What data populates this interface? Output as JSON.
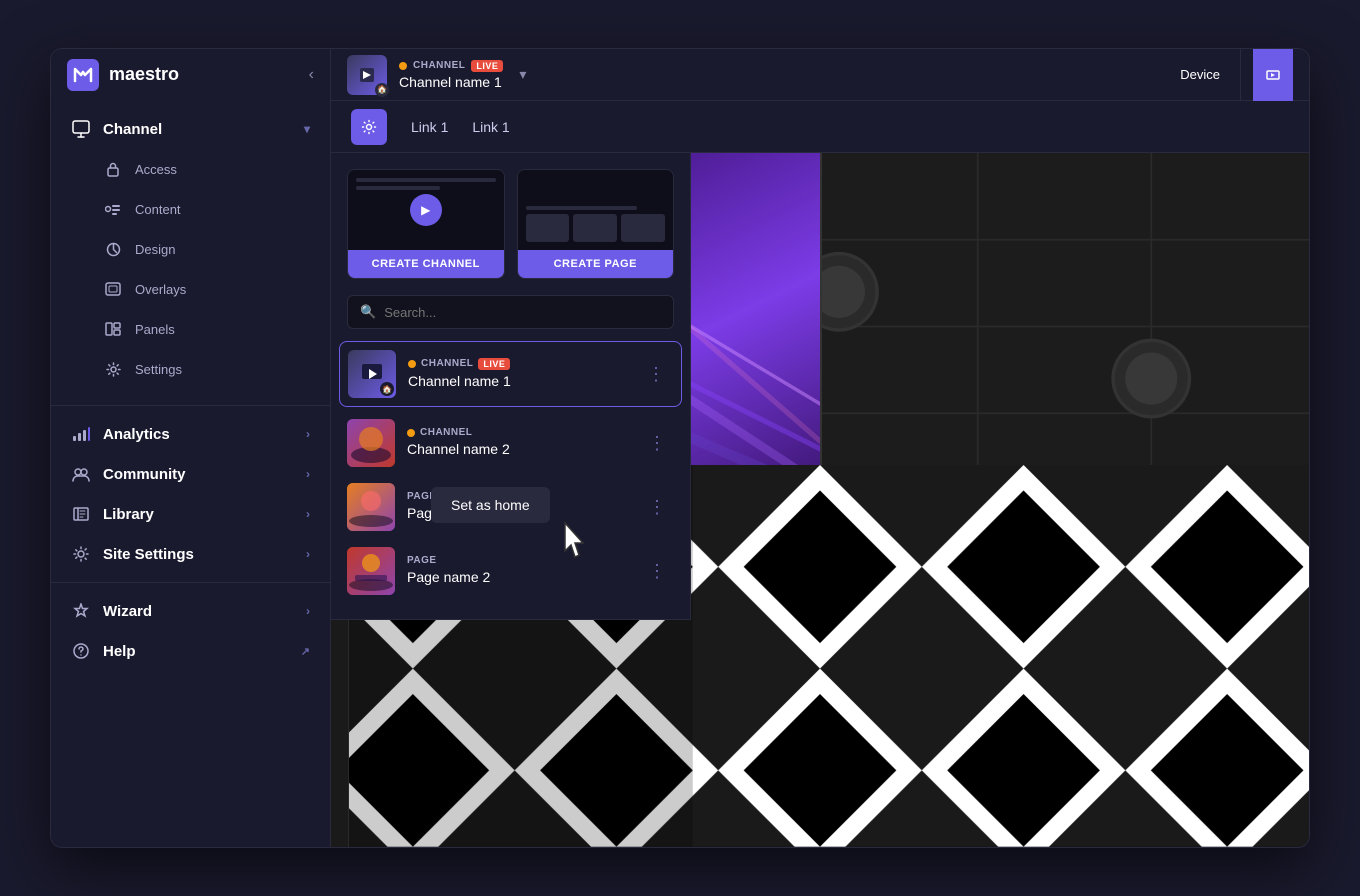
{
  "app": {
    "name": "maestro",
    "logo_letter": "M"
  },
  "top_bar": {
    "channel_badge": "CHANNEL",
    "live_badge": "LIVE",
    "channel_name": "Channel name 1",
    "device_label": "Device",
    "collapse_icon": "‹"
  },
  "sidebar": {
    "sections": [
      {
        "id": "channel",
        "label": "Channel",
        "icon": "▦",
        "has_chevron": true,
        "sub_items": [
          {
            "id": "access",
            "label": "Access",
            "icon": "🔒"
          },
          {
            "id": "content",
            "label": "Content",
            "icon": "📹"
          },
          {
            "id": "design",
            "label": "Design",
            "icon": "🎨"
          },
          {
            "id": "overlays",
            "label": "Overlays",
            "icon": "⬛"
          },
          {
            "id": "panels",
            "label": "Panels",
            "icon": "📋"
          },
          {
            "id": "settings",
            "label": "Settings",
            "icon": "⚙️"
          }
        ]
      },
      {
        "id": "analytics",
        "label": "Analytics",
        "icon": "📊",
        "has_chevron": true
      },
      {
        "id": "community",
        "label": "Community",
        "icon": "👥",
        "has_chevron": true
      },
      {
        "id": "library",
        "label": "Library",
        "icon": "📁",
        "has_chevron": true
      },
      {
        "id": "site-settings",
        "label": "Site Settings",
        "icon": "⚙️",
        "has_chevron": true
      }
    ],
    "bottom_items": [
      {
        "id": "wizard",
        "label": "Wizard",
        "icon": "✦",
        "has_chevron": true
      },
      {
        "id": "help",
        "label": "Help",
        "icon": "?",
        "has_external": true
      }
    ]
  },
  "dropdown": {
    "create_channel_label": "CREATE CHANNEL",
    "create_page_label": "CREATE PAGE",
    "search_placeholder": "Search...",
    "channels": [
      {
        "id": "ch1",
        "type": "CHANNEL",
        "type_label": "CHANNEL",
        "live": true,
        "name": "Channel name 1",
        "is_active": true
      },
      {
        "id": "ch2",
        "type": "CHANNEL",
        "type_label": "CHANNEL",
        "live": false,
        "name": "Channel name 2",
        "is_active": false
      },
      {
        "id": "pg1",
        "type": "PAGE",
        "type_label": "PAGE",
        "live": false,
        "name": "Page name 1",
        "is_active": false
      },
      {
        "id": "pg2",
        "type": "PAGE",
        "type_label": "PAGE",
        "live": false,
        "name": "Page name 2",
        "is_active": false
      }
    ]
  },
  "context_menu": {
    "set_as_home": "Set as home"
  },
  "preview": {
    "settings_icon": "⚙",
    "nav_link1": "Link 1",
    "nav_link2": "Link 1"
  }
}
